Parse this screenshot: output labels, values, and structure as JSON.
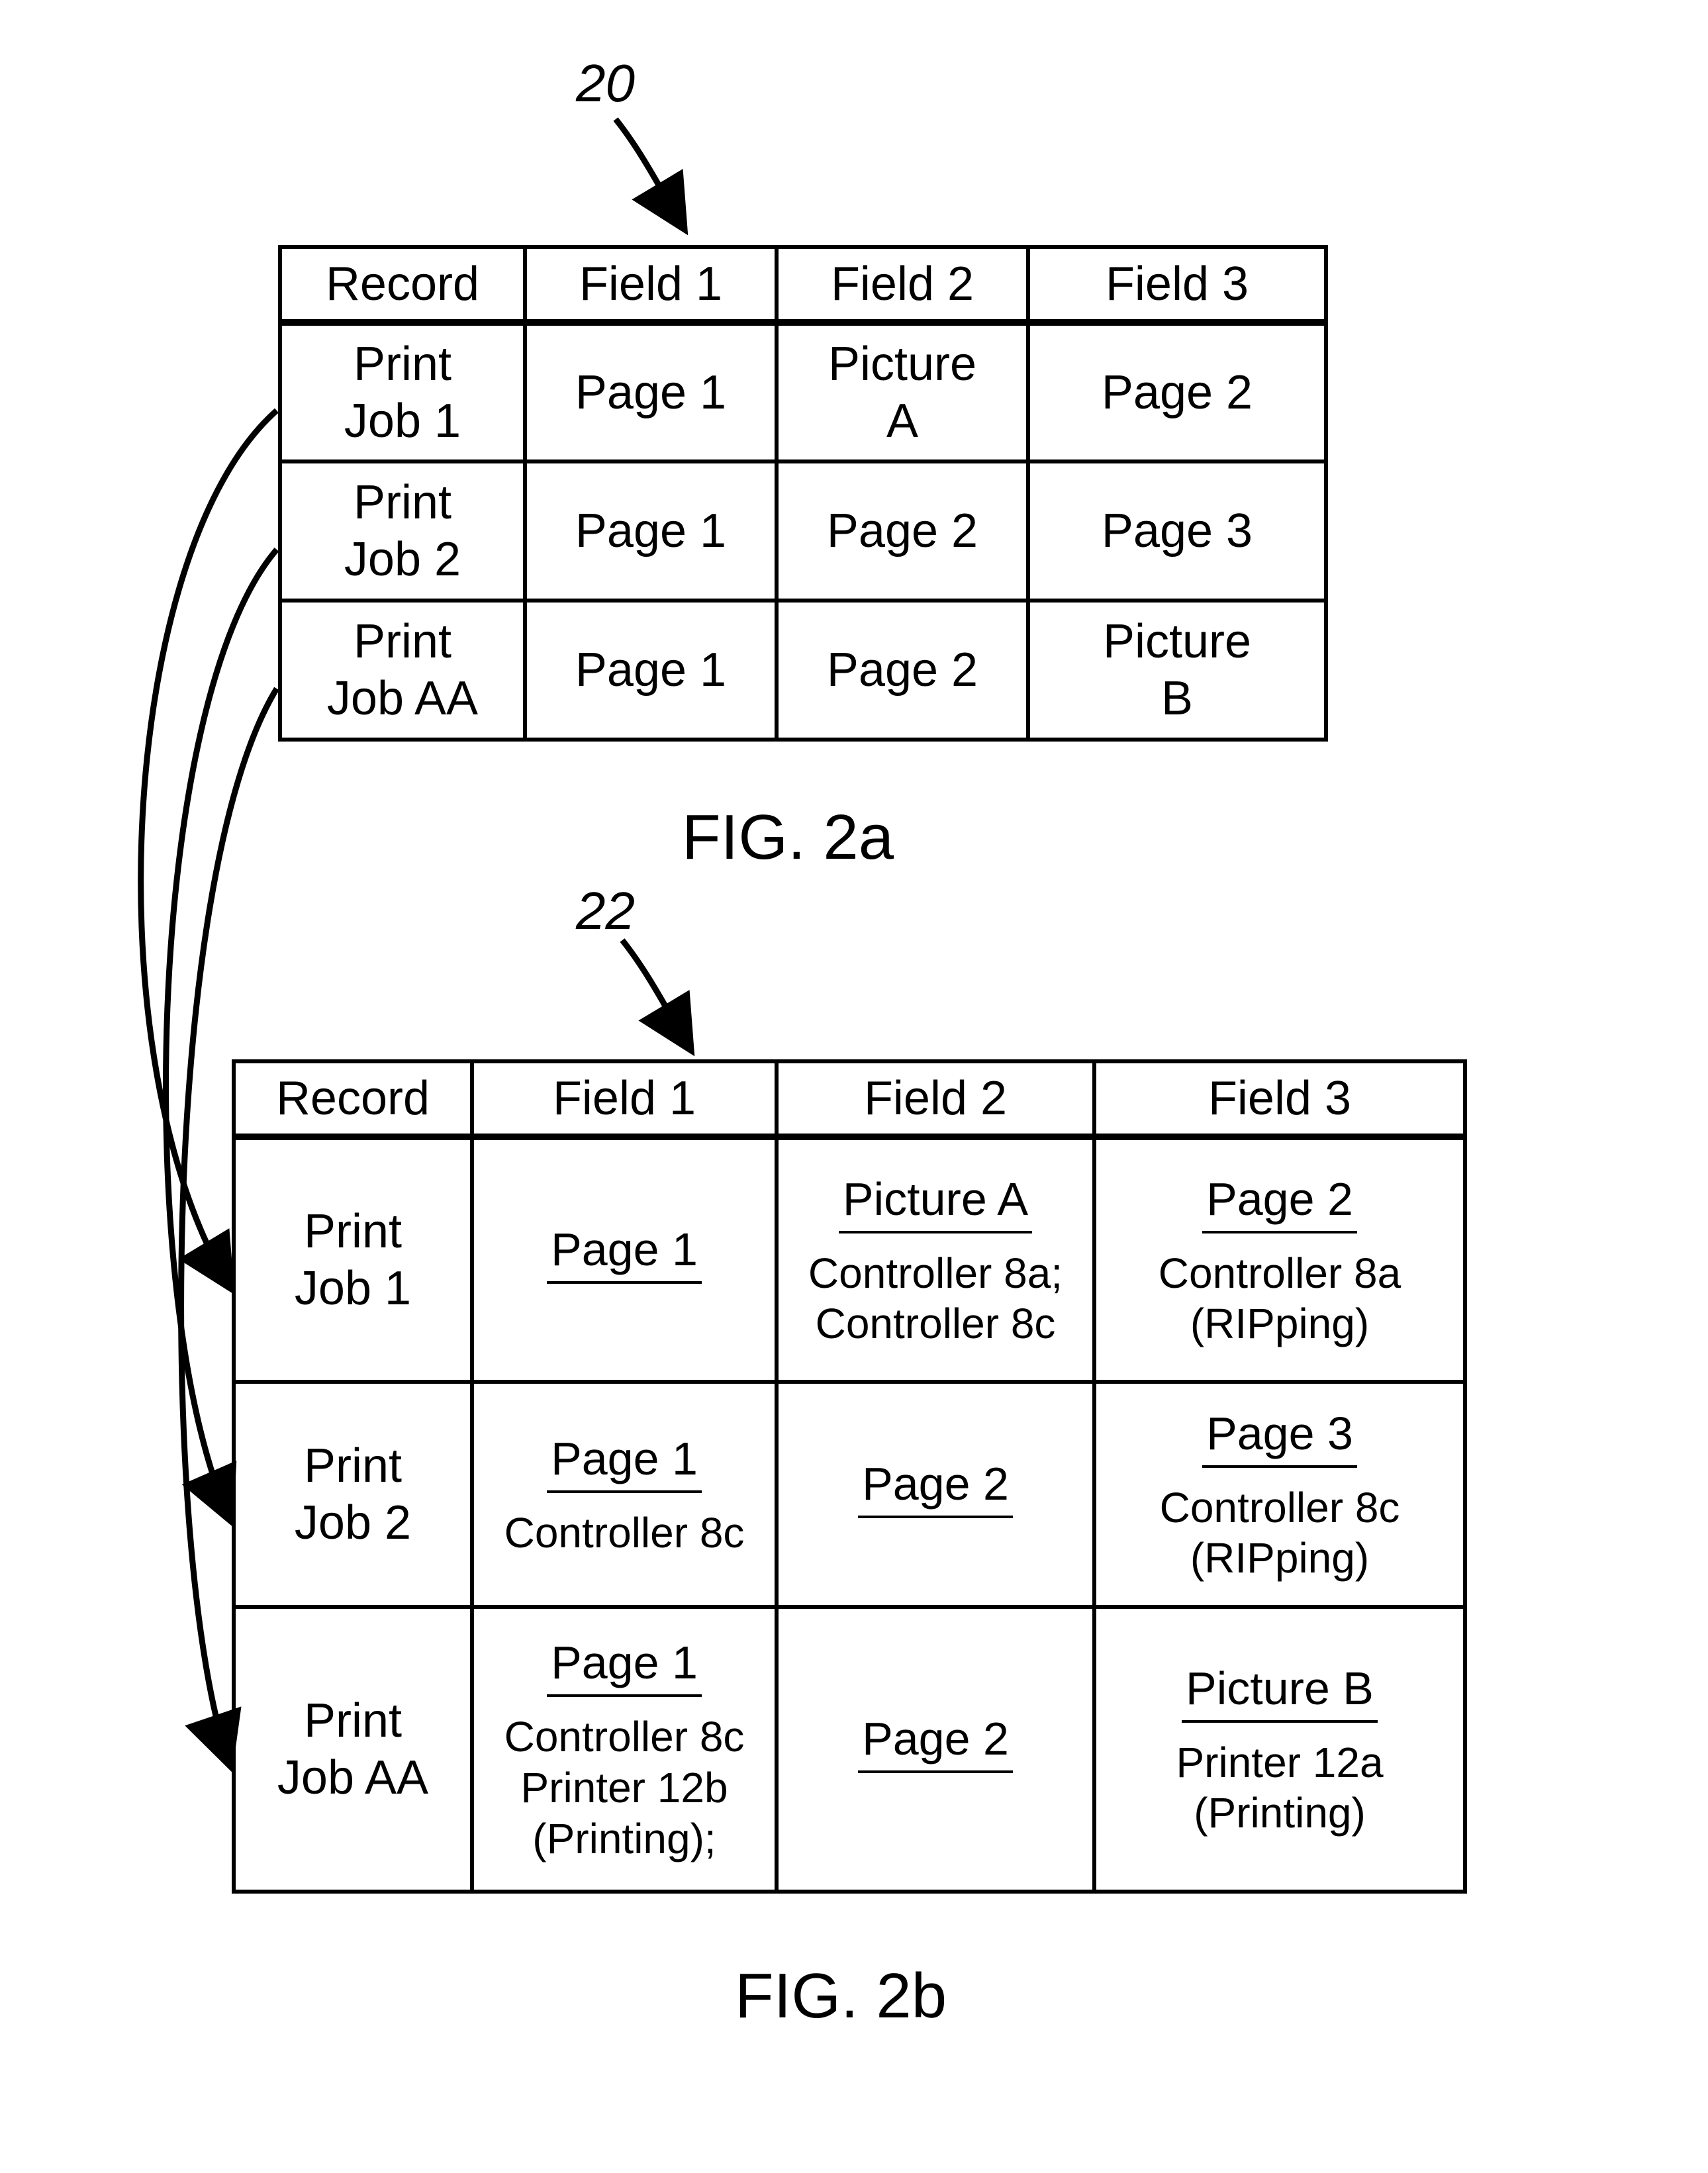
{
  "fig_a": {
    "ref": "20",
    "caption": "FIG. 2a",
    "headers": [
      "Record",
      "Field 1",
      "Field 2",
      "Field 3"
    ],
    "rows": [
      {
        "record": "Print\nJob 1",
        "f1": "Page 1",
        "f2": "Picture\nA",
        "f3": "Page 2"
      },
      {
        "record": "Print\nJob 2",
        "f1": "Page 1",
        "f2": "Page 2",
        "f3": "Page 3"
      },
      {
        "record": "Print\nJob AA",
        "f1": "Page 1",
        "f2": "Page 2",
        "f3": "Picture\nB"
      }
    ]
  },
  "fig_b": {
    "ref": "22",
    "caption": "FIG. 2b",
    "headers": [
      "Record",
      "Field 1",
      "Field 2",
      "Field 3"
    ],
    "rows": [
      {
        "record": "Print\nJob 1",
        "f1": {
          "head": "Page 1",
          "detail": ""
        },
        "f2": {
          "head": "Picture A",
          "detail": "Controller 8a;\nController 8c"
        },
        "f3": {
          "head": "Page 2",
          "detail": "Controller 8a\n(RIPping)"
        }
      },
      {
        "record": "Print\nJob 2",
        "f1": {
          "head": "Page 1",
          "detail": "Controller 8c"
        },
        "f2": {
          "head": "Page 2",
          "detail": ""
        },
        "f3": {
          "head": "Page 3",
          "detail": "Controller 8c\n(RIPping)"
        }
      },
      {
        "record": "Print\nJob AA",
        "f1": {
          "head": "Page 1",
          "detail": "Controller 8c\nPrinter 12b\n(Printing);"
        },
        "f2": {
          "head": "Page 2",
          "detail": ""
        },
        "f3": {
          "head": "Picture B",
          "detail": "Printer 12a\n(Printing)"
        }
      }
    ]
  }
}
